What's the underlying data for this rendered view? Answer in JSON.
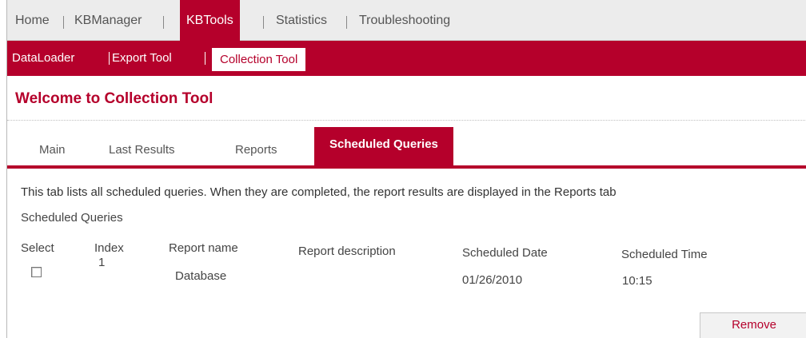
{
  "top_nav": {
    "items": [
      {
        "label": "Home",
        "active": false
      },
      {
        "label": "KBManager",
        "active": false
      },
      {
        "label": "KBTools",
        "active": true
      },
      {
        "label": "Statistics",
        "active": false
      },
      {
        "label": "Troubleshooting",
        "active": false
      }
    ]
  },
  "sub_nav": {
    "items": [
      {
        "label": "DataLoader",
        "active": false
      },
      {
        "label": "Export Tool",
        "active": false
      },
      {
        "label": "Collection Tool",
        "active": true
      }
    ]
  },
  "page_title": "Welcome to Collection Tool",
  "tabs": [
    {
      "label": "Main",
      "active": false
    },
    {
      "label": "Last Results",
      "active": false
    },
    {
      "label": "Reports",
      "active": false
    },
    {
      "label": "Scheduled Queries",
      "active": true
    }
  ],
  "description": "This tab lists all scheduled queries. When they are completed, the report results are displayed in the Reports tab",
  "section_title": "Scheduled Queries",
  "table": {
    "columns": [
      "Select",
      "Index",
      "Report name",
      "Report description",
      "Scheduled Date",
      "Scheduled Time"
    ],
    "rows": [
      {
        "selected": false,
        "index": "1",
        "report_name": "Database",
        "report_description": "",
        "scheduled_date": "01/26/2010",
        "scheduled_time": "10:15"
      }
    ]
  },
  "remove_label": "Remove",
  "colors": {
    "accent": "#b5002b",
    "nav_bg": "#ececec"
  }
}
